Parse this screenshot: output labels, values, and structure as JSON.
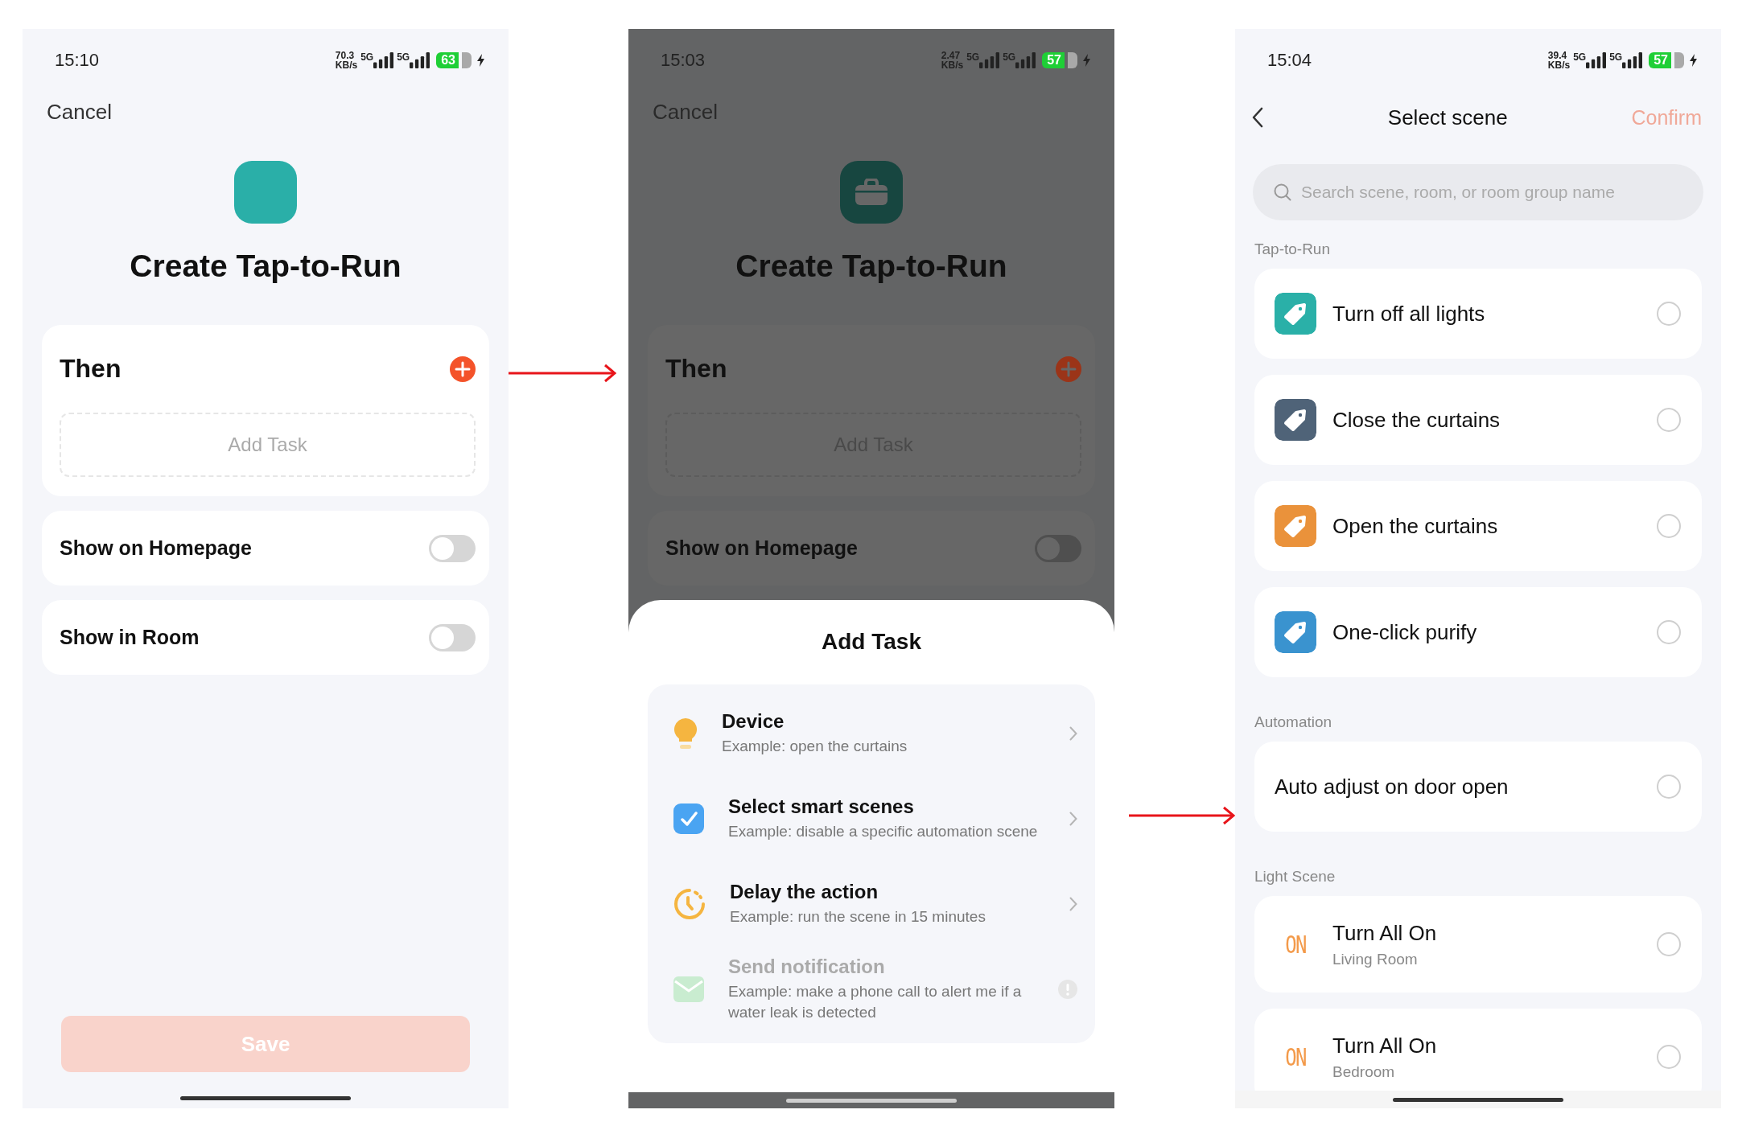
{
  "screens": [
    {
      "kind": "create",
      "dimmed": false,
      "status": {
        "time": "15:10",
        "speed": "70.3",
        "speed_unit": "KB/s",
        "network_1": "5G",
        "network_2": "5G",
        "battery": "63"
      },
      "cancel": "Cancel",
      "icon_glyph": false,
      "title": "Create Tap-to-Run",
      "then_card": {
        "title": "Then",
        "add_task": "Add Task"
      },
      "toggles": [
        {
          "label": "Show on Homepage",
          "on": false
        },
        {
          "label": "Show in Room",
          "on": false
        }
      ],
      "save": {
        "label": "Save",
        "disabled": true
      }
    },
    {
      "kind": "create",
      "dimmed": true,
      "status": {
        "time": "15:03",
        "speed": "2.47",
        "speed_unit": "KB/s",
        "network_1": "5G",
        "network_2": "5G",
        "battery": "57"
      },
      "cancel": "Cancel",
      "icon_glyph": true,
      "title": "Create Tap-to-Run",
      "then_card": {
        "title": "Then",
        "add_task": "Add Task"
      },
      "toggles": [
        {
          "label": "Show on Homepage",
          "on": false
        }
      ],
      "sheet": {
        "title": "Add Task",
        "options": [
          {
            "kind": "device",
            "title": "Device",
            "subtitle": "Example: open the curtains",
            "disabled": false
          },
          {
            "kind": "scene",
            "title": "Select smart scenes",
            "subtitle": "Example: disable a specific automation scene",
            "disabled": false
          },
          {
            "kind": "delay",
            "title": "Delay the action",
            "subtitle": "Example: run the scene in 15 minutes",
            "disabled": false
          },
          {
            "kind": "notify",
            "title": "Send notification",
            "subtitle": "Example: make a phone call to alert me if a water leak is detected",
            "disabled": true
          }
        ]
      }
    },
    {
      "kind": "select",
      "status": {
        "time": "15:04",
        "speed": "39.4",
        "speed_unit": "KB/s",
        "network_1": "5G",
        "network_2": "5G",
        "battery": "57"
      },
      "nav": {
        "title": "Select scene",
        "confirm": {
          "label": "Confirm",
          "disabled": true
        }
      },
      "search": {
        "placeholder": "Search scene, room, or room group name"
      },
      "sections": [
        {
          "title": "Tap-to-Run",
          "items": [
            {
              "kind": "tag",
              "title": "Turn off all lights",
              "color": "#2ab0a8",
              "selected": false
            },
            {
              "kind": "tag",
              "title": "Close the curtains",
              "color": "#4f6378",
              "selected": false
            },
            {
              "kind": "tag",
              "title": "Open the curtains",
              "color": "#ea923b",
              "selected": false
            },
            {
              "kind": "tag",
              "title": "One-click purify",
              "color": "#3a93cf",
              "selected": false
            }
          ]
        },
        {
          "title": "Automation",
          "items": [
            {
              "kind": "plain",
              "title": "Auto adjust on door open",
              "selected": false
            }
          ]
        },
        {
          "title": "Light Scene",
          "items": [
            {
              "kind": "light",
              "badge": "ON",
              "title": "Turn All On",
              "subtitle": "Living Room",
              "selected": false
            },
            {
              "kind": "light",
              "badge": "ON",
              "title": "Turn All On",
              "subtitle": "Bedroom",
              "selected": false
            }
          ]
        }
      ]
    }
  ]
}
